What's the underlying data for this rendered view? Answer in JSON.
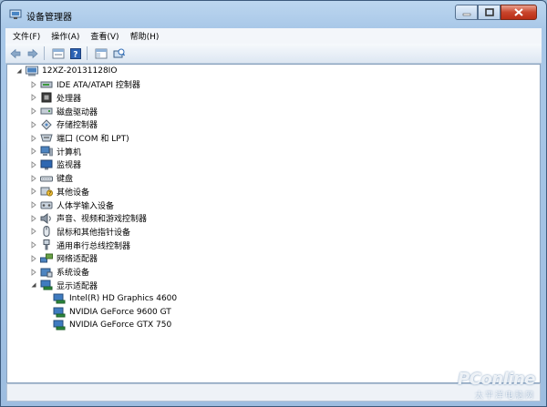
{
  "window": {
    "title": "设备管理器",
    "icon": "device-manager-icon"
  },
  "menu": [
    {
      "label": "文件(F)"
    },
    {
      "label": "操作(A)"
    },
    {
      "label": "查看(V)"
    },
    {
      "label": "帮助(H)"
    }
  ],
  "toolbar": [
    {
      "name": "back-icon"
    },
    {
      "name": "forward-icon"
    },
    {
      "name": "properties-icon"
    },
    {
      "name": "help-icon"
    },
    {
      "name": "console-tree-icon"
    },
    {
      "name": "scan-hardware-icon"
    }
  ],
  "tree": {
    "root": {
      "label": "12XZ-20131128IO",
      "icon": "computer-icon",
      "expanded": true
    },
    "categories": [
      {
        "label": "IDE ATA/ATAPI 控制器",
        "icon": "ide-controller-icon"
      },
      {
        "label": "处理器",
        "icon": "processor-icon"
      },
      {
        "label": "磁盘驱动器",
        "icon": "disk-drive-icon"
      },
      {
        "label": "存储控制器",
        "icon": "storage-controller-icon"
      },
      {
        "label": "端口 (COM 和 LPT)",
        "icon": "port-icon"
      },
      {
        "label": "计算机",
        "icon": "computer-monitor-icon"
      },
      {
        "label": "监视器",
        "icon": "monitor-icon"
      },
      {
        "label": "键盘",
        "icon": "keyboard-icon"
      },
      {
        "label": "其他设备",
        "icon": "other-devices-icon"
      },
      {
        "label": "人体学输入设备",
        "icon": "hid-icon"
      },
      {
        "label": "声音、视频和游戏控制器",
        "icon": "sound-icon"
      },
      {
        "label": "鼠标和其他指针设备",
        "icon": "mouse-icon"
      },
      {
        "label": "通用串行总线控制器",
        "icon": "usb-icon"
      },
      {
        "label": "网络适配器",
        "icon": "network-adapter-icon"
      },
      {
        "label": "系统设备",
        "icon": "system-devices-icon"
      },
      {
        "label": "显示适配器",
        "icon": "display-adapter-icon",
        "expanded": true,
        "children": [
          {
            "label": "Intel(R) HD Graphics 4600"
          },
          {
            "label": "NVIDIA GeForce 9600 GT"
          },
          {
            "label": "NVIDIA GeForce GTX 750"
          }
        ]
      }
    ]
  },
  "watermark": {
    "line1": "PConline",
    "line2": "太平洋电脑网"
  }
}
